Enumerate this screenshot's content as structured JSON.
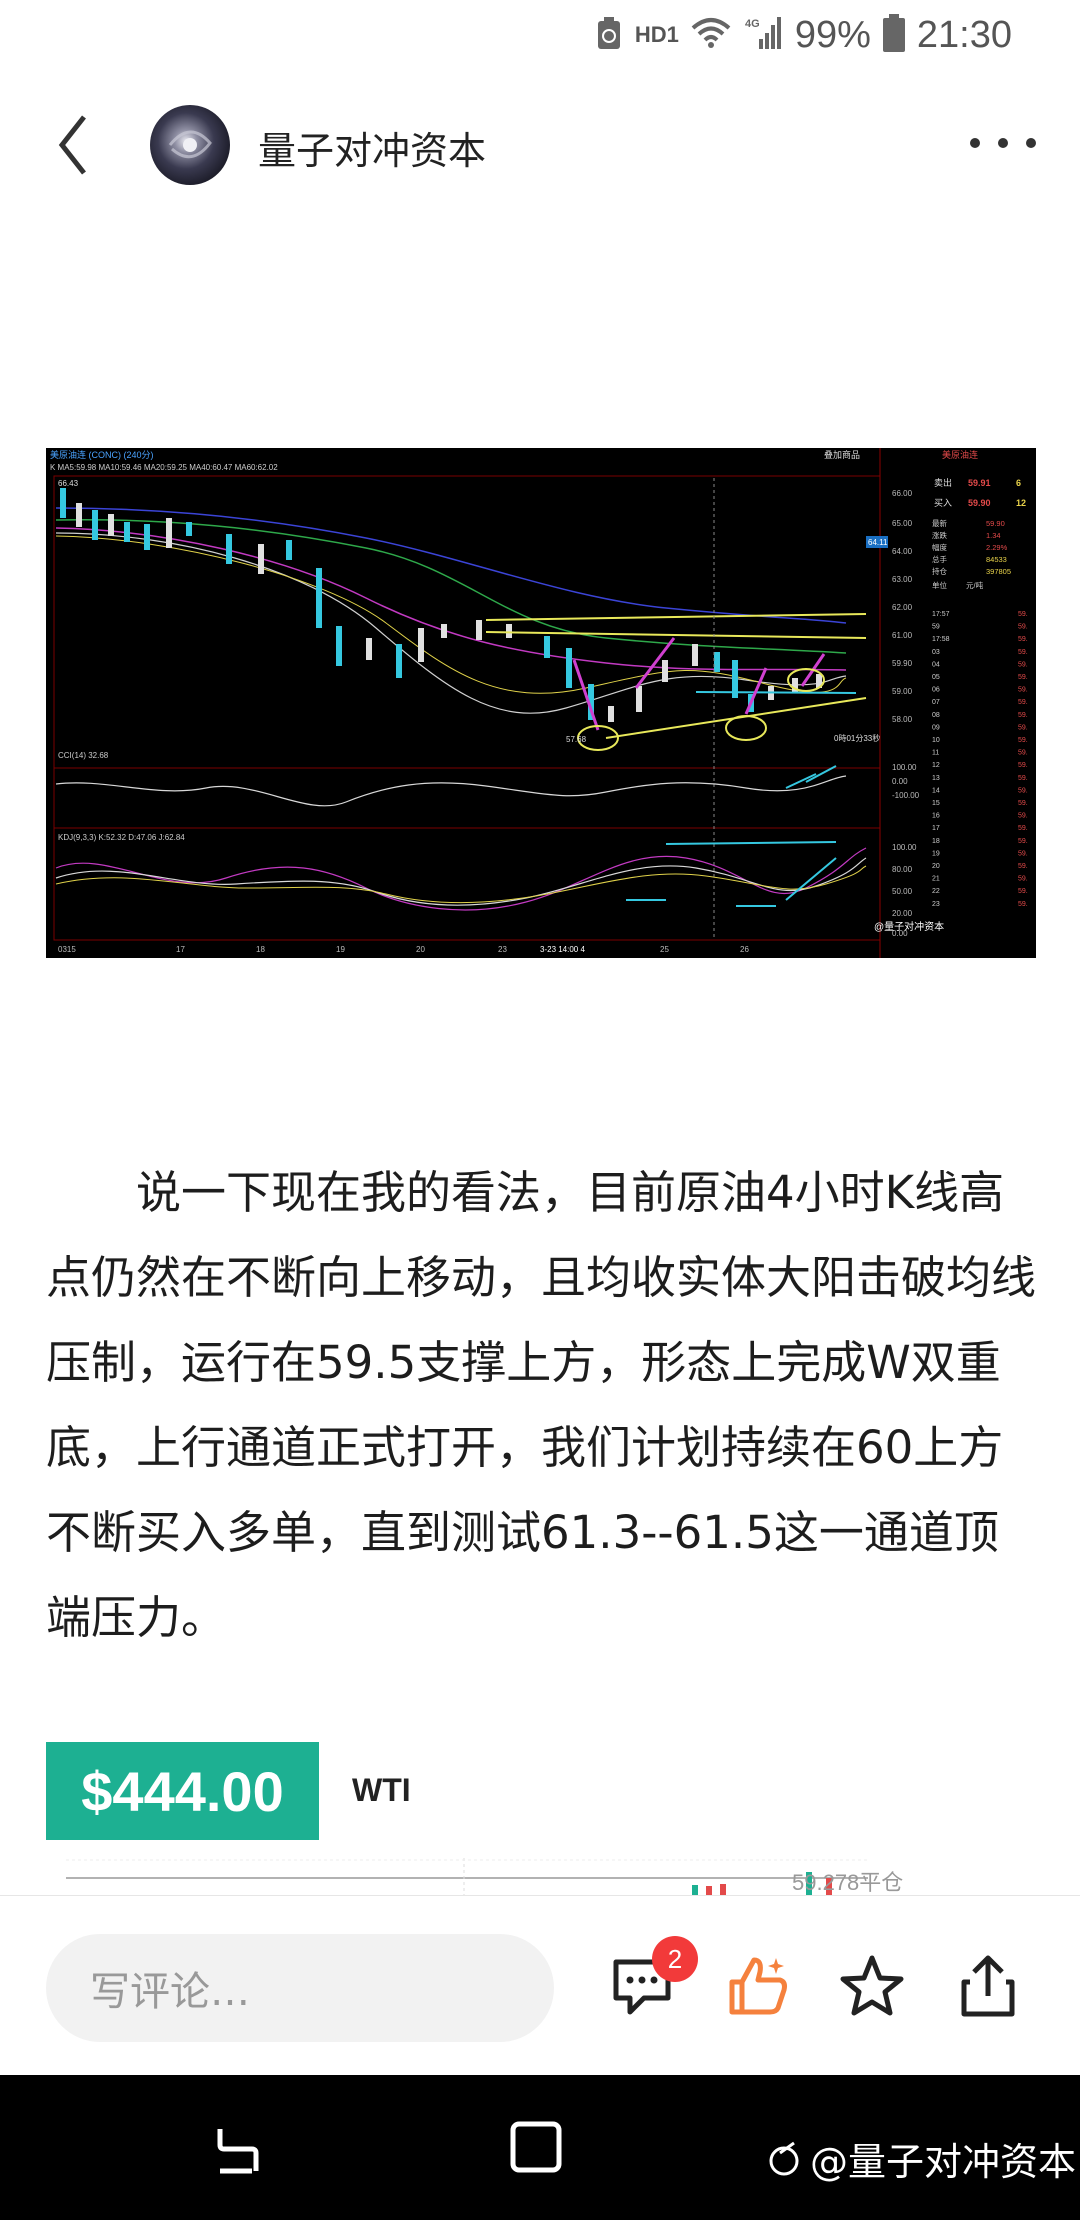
{
  "status_bar": {
    "network_label": "HD1",
    "signal_label": "4G",
    "battery": "99%",
    "time": "21:30"
  },
  "header": {
    "channel_name": "量子对冲资本",
    "back_icon": "chevron-left-icon",
    "more_icon": "more-horizontal-icon"
  },
  "chart_image": {
    "title": "美原油连 (CONC) (240分)",
    "ma_line": "K MA5:59.98 MA10:59.46 MA20:59.25 MA40:60.47 MA60:62.02",
    "high_label": "66.43",
    "low_label": "57.68",
    "price_ticks": [
      "66.00",
      "65.00",
      "64.00",
      "63.00",
      "62.00",
      "61.00",
      "59.90",
      "59.00",
      "58.00"
    ],
    "cci_label": "CCI(14) 32.68",
    "cci_ticks": [
      "100.00",
      "0.00",
      "-100.00"
    ],
    "kdj_label": "KDJ(9,3,3) K:52.32 D:47.06 J:62.84",
    "kdj_ticks": [
      "100.00",
      "80.00",
      "50.00",
      "20.00",
      "0.00"
    ],
    "date_ticks": [
      "0315",
      "17",
      "18",
      "19",
      "20",
      "23",
      "3-23 14:00 4",
      "25",
      "26"
    ],
    "countdown": "0時01分33秒",
    "cursor_price": "64.11",
    "dropdown": "叠加商品",
    "side": {
      "name": "美原油连",
      "sell_label": "卖出",
      "sell_price": "59.91",
      "sell_qty": "6",
      "buy_label": "买入",
      "buy_price": "59.90",
      "buy_qty": "12",
      "rows": [
        [
          "最新",
          "59.90"
        ],
        [
          "涨跌",
          "1.34"
        ],
        [
          "幅度",
          "2.29%"
        ],
        [
          "总手",
          "84533"
        ],
        [
          "持仓",
          "397805"
        ],
        [
          "单位",
          "元/吨"
        ]
      ],
      "times": [
        "17:57",
        "59",
        "17:58",
        "03",
        "04",
        "05",
        "06",
        "07",
        "08",
        "09",
        "10",
        "11",
        "12",
        "13",
        "14",
        "15",
        "16",
        "17",
        "18",
        "19",
        "20",
        "21",
        "22",
        "23"
      ]
    },
    "watermark": "@量子对冲资本"
  },
  "article": {
    "paragraph": "说一下现在我的看法，目前原油4小时K线高点仍然在不断向上移动，且均收实体大阳击破均线压制，运行在59.5支撑上方，形态上完成W双重底，上行通道正式打开，我们计划持续在60上方不断买入多单，直到测试61.3--61.5这一通道顶端压力。"
  },
  "price_card": {
    "price": "$444.00",
    "instrument": "WTI",
    "mini_label": "59.278平仓"
  },
  "bottom_bar": {
    "comment_placeholder": "写评论…",
    "comment_count": "2",
    "comment_icon": "comment-icon",
    "like_icon": "thumbs-up-icon",
    "star_icon": "star-icon",
    "share_icon": "share-icon"
  },
  "nav_bar": {
    "watermark": "@量子对冲资本"
  },
  "colors": {
    "accent": "#1db092",
    "badge": "#f23a3a",
    "like": "#f5813d"
  }
}
